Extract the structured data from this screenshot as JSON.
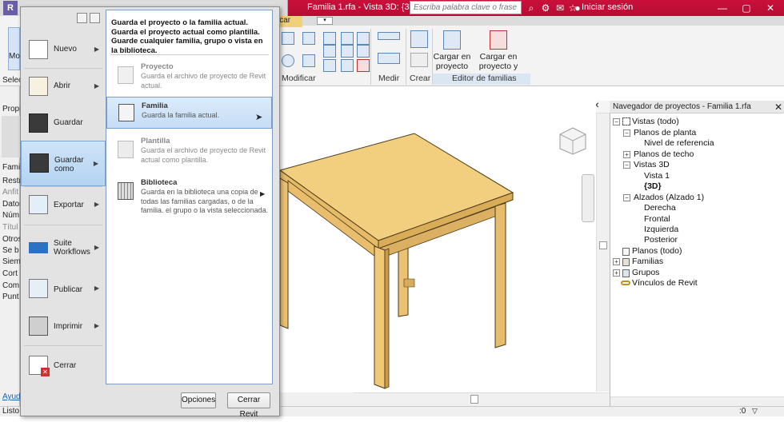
{
  "titlebar": {
    "document_title": "Familia 1.rfa - Vista 3D: {3D}",
    "search_placeholder": "Escriba palabra clave o frase",
    "login_label": "Iniciar sesión",
    "accent_color": "#c30e38"
  },
  "ribbon": {
    "tab_label": "ificar",
    "groups": {
      "modificar": "Modificar",
      "medir": "Medir",
      "crear": "Crear",
      "editor": "Editor de familias"
    },
    "buttons": {
      "load_project_l1": "Cargar en",
      "load_project_l2": "proyecto",
      "load_close_l1": "Cargar en",
      "load_close_l2": "proyecto y cerrar"
    }
  },
  "left_panel": {
    "select": "Selec",
    "props": "Propi",
    "family": "Famil",
    "restr": "Restri",
    "anfi": "Anfit",
    "datos": "Datos",
    "num": "Núm",
    "titu": "Títul",
    "otros": "Otros",
    "seb": "Se b",
    "siem": "Siem",
    "cort": "Cort",
    "com": "Com",
    "punt": "Punt",
    "ayuda": "Ayuda"
  },
  "app_menu": {
    "items": [
      {
        "label": "Nuevo"
      },
      {
        "label": "Abrir"
      },
      {
        "label": "Guardar"
      },
      {
        "label": "Guardar como"
      },
      {
        "label": "Exportar"
      },
      {
        "label": "Suite Workflows"
      },
      {
        "label": "Publicar"
      },
      {
        "label": "Imprimir"
      },
      {
        "label": "Cerrar"
      }
    ],
    "submenu_header": "Guarda el proyecto o la familia actual. Guarda el proyecto actual como plantilla. Guarde cualquier familia, grupo o vista en la biblioteca.",
    "submenu": [
      {
        "title": "Proyecto",
        "desc": "Guarda el archivo de proyecto de Revit actual."
      },
      {
        "title": "Familia",
        "desc": "Guarda la familia actual."
      },
      {
        "title": "Plantilla",
        "desc": "Guarda el archivo de proyecto de Revit actual como plantilla."
      },
      {
        "title": "Biblioteca",
        "desc": "Guarda en la biblioteca una copia de todas las familias cargadas, o de la familia. el grupo o la vista seleccionada."
      }
    ],
    "options_button": "Opciones",
    "exit_button": "Cerrar Revit"
  },
  "browser": {
    "title": "Navegador de proyectos - Familia 1.rfa",
    "nodes": {
      "vistas": "Vistas (todo)",
      "planos_planta": "Planos de planta",
      "nivel_ref": "Nivel de referencia",
      "planos_techo": "Planos de techo",
      "vistas3d": "Vistas 3D",
      "vista1": "Vista 1",
      "v3d": "{3D}",
      "alzados": "Alzados (Alzado 1)",
      "derecha": "Derecha",
      "frontal": "Frontal",
      "izquierda": "Izquierda",
      "posterior": "Posterior",
      "planos_todo": "Planos (todo)",
      "familias": "Familias",
      "grupos": "Grupos",
      "vinculos": "Vínculos de Revit"
    }
  },
  "status": {
    "text": "Listo",
    "zero": ":0"
  },
  "colors": {
    "table_top": "#f2cf7e",
    "table_side": "#e0b35e",
    "table_leg": "#ebc273",
    "selection": "#c5ddf6"
  }
}
